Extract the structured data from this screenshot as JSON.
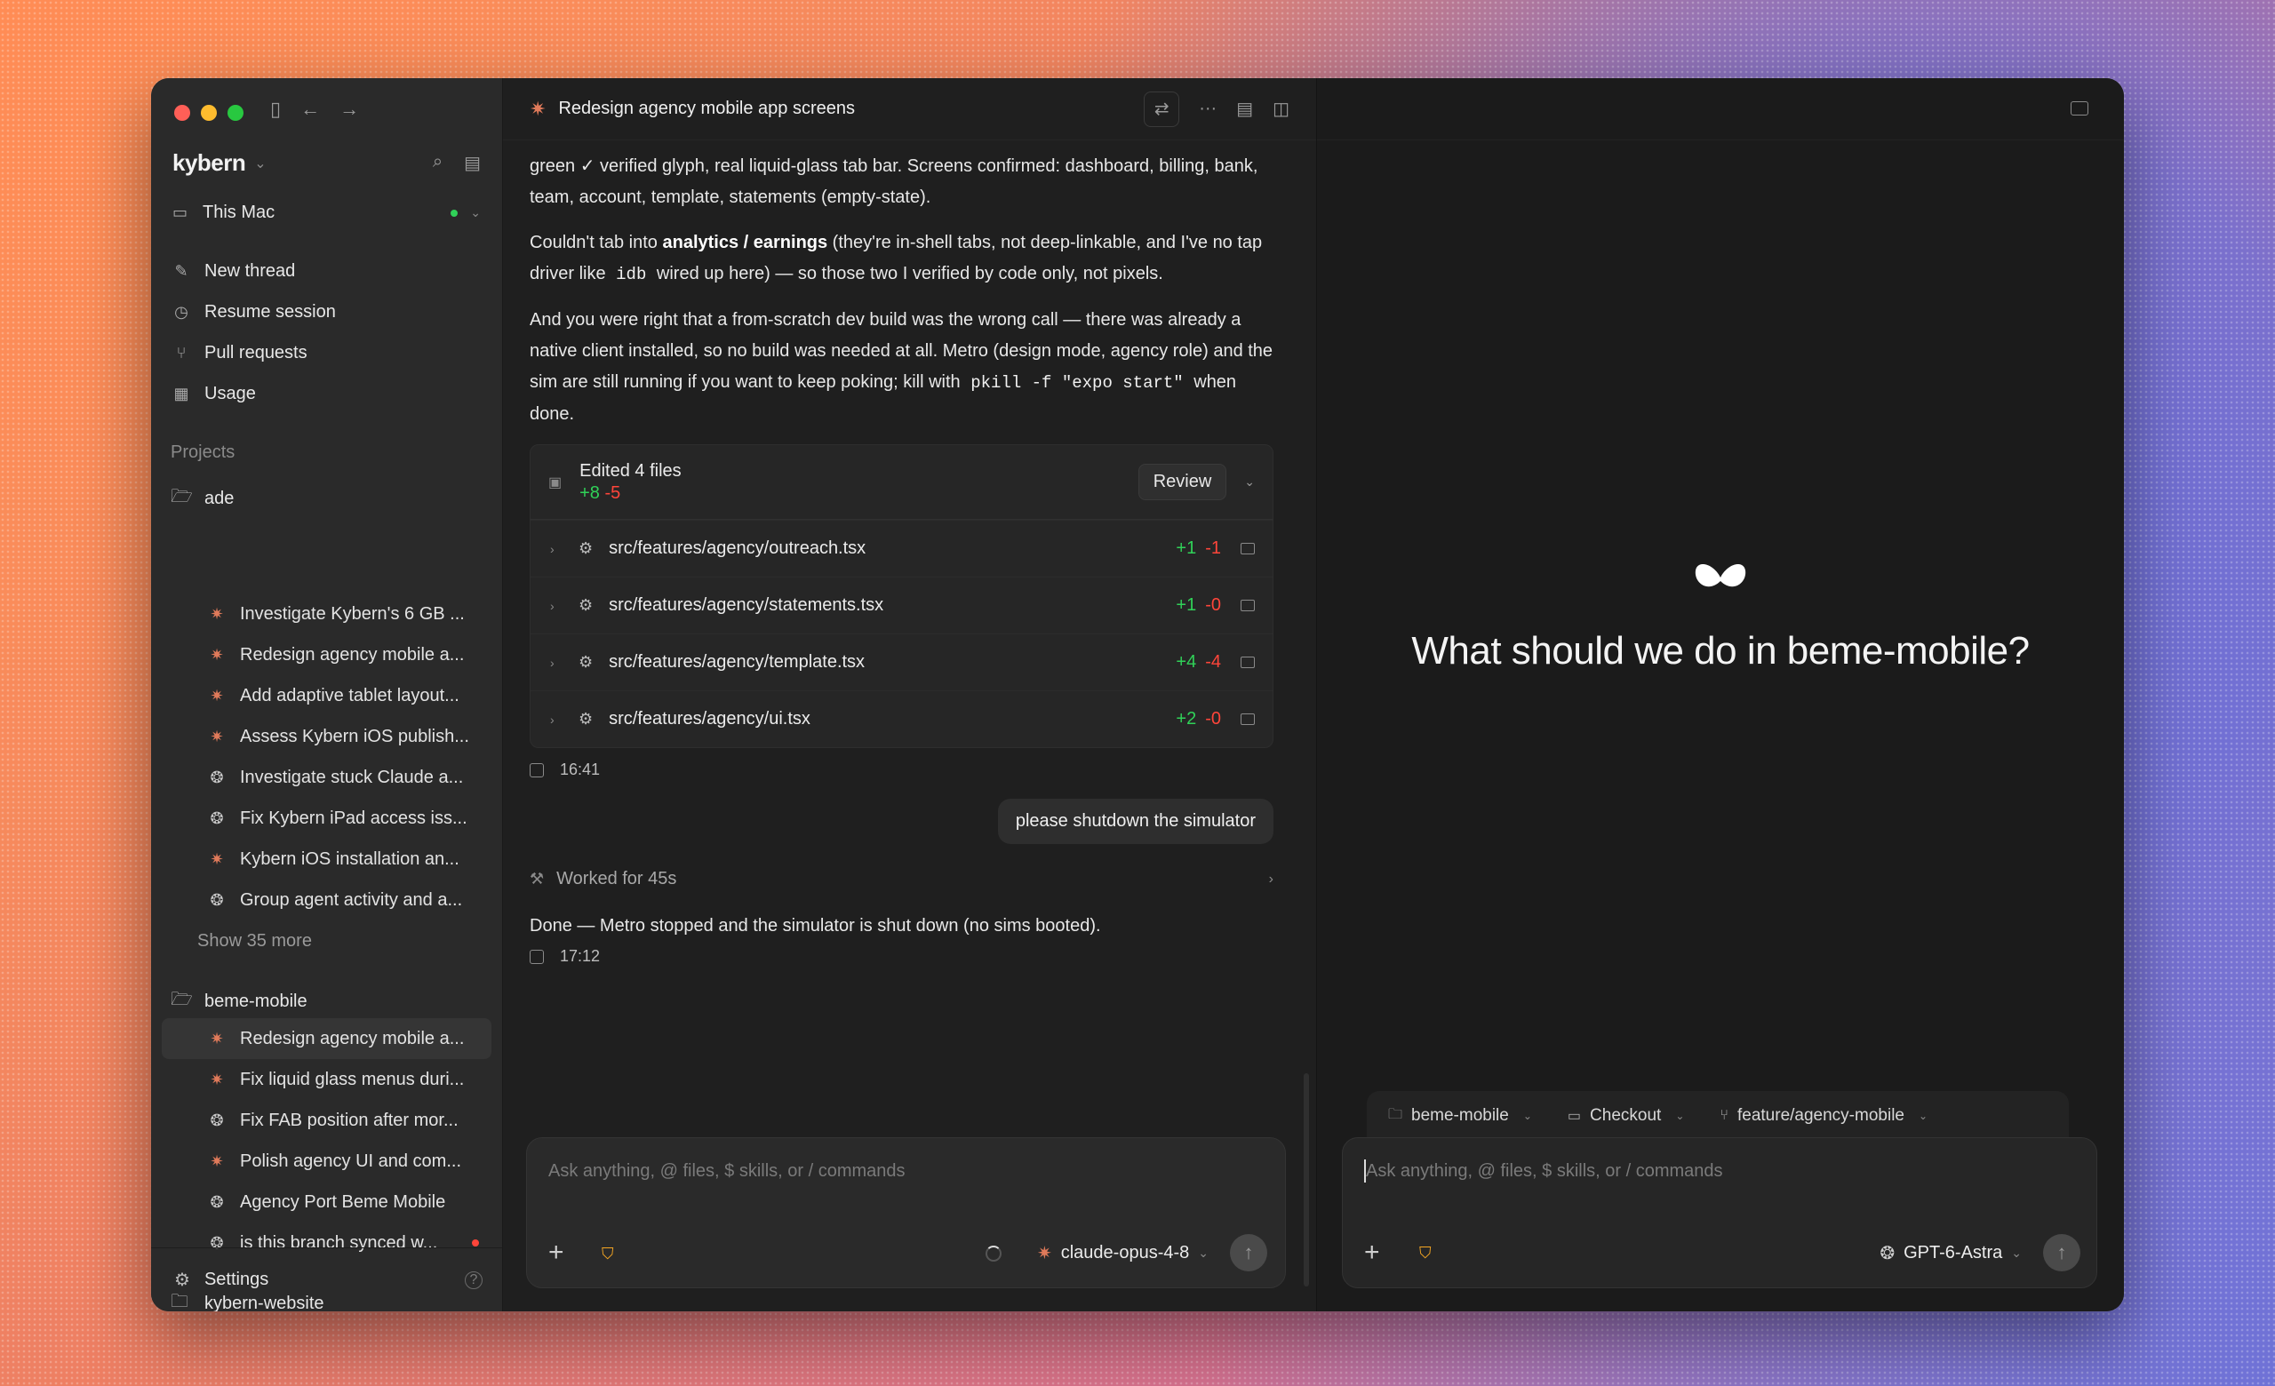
{
  "sidebar": {
    "workspace": "kybern",
    "machine": "This Mac",
    "nav": [
      {
        "label": "New thread",
        "icon": "compose-icon"
      },
      {
        "label": "Resume session",
        "icon": "clock-icon"
      },
      {
        "label": "Pull requests",
        "icon": "pull-request-icon"
      },
      {
        "label": "Usage",
        "icon": "chart-icon"
      }
    ],
    "projects_label": "Projects",
    "projects": [
      {
        "name": "ade",
        "threads": [
          {
            "label": "Investigate Kybern's 6 GB ...",
            "agent": "claude"
          },
          {
            "label": "Redesign agency mobile a...",
            "agent": "claude"
          },
          {
            "label": "Add adaptive tablet layout...",
            "agent": "claude"
          },
          {
            "label": "Assess Kybern iOS publish...",
            "agent": "claude"
          },
          {
            "label": "Investigate stuck Claude a...",
            "agent": "gpt"
          },
          {
            "label": "Fix Kybern iPad access iss...",
            "agent": "gpt"
          },
          {
            "label": "Kybern iOS installation an...",
            "agent": "claude"
          },
          {
            "label": "Group agent activity and a...",
            "agent": "gpt"
          }
        ],
        "show_more": "Show 35 more"
      },
      {
        "name": "beme-mobile",
        "threads": [
          {
            "label": "Redesign agency mobile a...",
            "agent": "claude"
          },
          {
            "label": "Fix liquid glass menus duri...",
            "agent": "claude"
          },
          {
            "label": "Fix FAB position after mor...",
            "agent": "gpt"
          },
          {
            "label": "Polish agency UI and com...",
            "agent": "claude"
          },
          {
            "label": "Agency Port Beme Mobile",
            "agent": "gpt"
          },
          {
            "label": "is this branch synced w...",
            "agent": "gpt"
          }
        ]
      },
      {
        "name": "kybern-website"
      }
    ],
    "settings": "Settings"
  },
  "chat": {
    "title": "Redesign agency mobile app screens",
    "para1": "green ✓ verified glyph, real liquid-glass tab bar. Screens confirmed: dashboard, billing, bank, team, account, template, statements (empty-state).",
    "para2_a": "Couldn't tab into ",
    "para2_b": "analytics / earnings",
    "para2_c": " (they're in-shell tabs, not deep-linkable, and I've no tap driver like ",
    "para2_code": "idb",
    "para2_d": " wired up here) — so those two I verified by code only, not pixels.",
    "para3_a": "And you were right that a from-scratch dev build was the wrong call — there was already a native client installed, so no build was needed at all. Metro (design mode, agency role) and the sim are still running if you want to keep poking; kill with ",
    "para3_code": "pkill -f \"expo start\"",
    "para3_b": " when done.",
    "edits": {
      "title": "Edited 4 files",
      "added": "+8",
      "removed": "-5",
      "review": "Review",
      "files": [
        {
          "path": "src/features/agency/outreach.tsx",
          "added": "+1",
          "removed": "-1"
        },
        {
          "path": "src/features/agency/statements.tsx",
          "added": "+1",
          "removed": "-0"
        },
        {
          "path": "src/features/agency/template.tsx",
          "added": "+4",
          "removed": "-4"
        },
        {
          "path": "src/features/agency/ui.tsx",
          "added": "+2",
          "removed": "-0"
        }
      ]
    },
    "time1": "16:41",
    "user_message": "please shutdown the simulator",
    "worked": "Worked for 45s",
    "reply": "Done — Metro stopped and the simulator is shut down (no sims booted).",
    "time2": "17:12",
    "composer_placeholder": "Ask anything, @ files, $ skills, or / commands",
    "model": "claude-opus-4-8"
  },
  "right": {
    "hero": "What should we do in beme-mobile?",
    "context": [
      {
        "label": "beme-mobile",
        "icon": "folder-icon"
      },
      {
        "label": "Checkout",
        "icon": "laptop-icon"
      },
      {
        "label": "feature/agency-mobile",
        "icon": "branch-icon"
      }
    ],
    "composer_placeholder": "Ask anything, @ files, $ skills, or / commands",
    "model": "GPT-6-Astra"
  },
  "colors": {
    "accent_claude": "#e07a5a",
    "added": "#30d158",
    "removed": "#ff453a",
    "warning": "#f5a623"
  }
}
